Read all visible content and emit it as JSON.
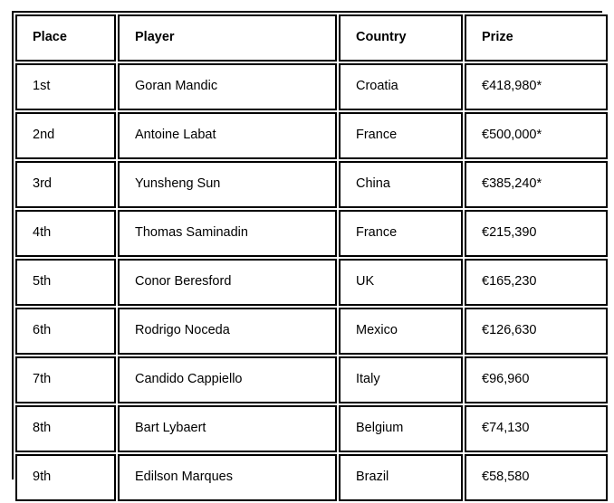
{
  "table": {
    "columns": [
      {
        "key": "place",
        "label": "Place"
      },
      {
        "key": "player",
        "label": "Player"
      },
      {
        "key": "country",
        "label": "Country"
      },
      {
        "key": "prize",
        "label": "Prize"
      }
    ],
    "rows": [
      {
        "place": "1st",
        "player": "Goran Mandic",
        "country": "Croatia",
        "prize": "€418,980*"
      },
      {
        "place": "2nd",
        "player": "Antoine Labat",
        "country": "France",
        "prize": "€500,000*"
      },
      {
        "place": "3rd",
        "player": "Yunsheng Sun",
        "country": "China",
        "prize": "€385,240*"
      },
      {
        "place": "4th",
        "player": "Thomas Saminadin",
        "country": "France",
        "prize": "€215,390"
      },
      {
        "place": "5th",
        "player": "Conor Beresford",
        "country": "UK",
        "prize": "€165,230"
      },
      {
        "place": "6th",
        "player": "Rodrigo Noceda",
        "country": "Mexico",
        "prize": "€126,630"
      },
      {
        "place": "7th",
        "player": "Candido Cappiello",
        "country": "Italy",
        "prize": "€96,960"
      },
      {
        "place": "8th",
        "player": "Bart Lybaert",
        "country": "Belgium",
        "prize": "€74,130"
      },
      {
        "place": "9th",
        "player": "Edilson Marques",
        "country": "Brazil",
        "prize": "€58,580"
      }
    ]
  },
  "colors": {
    "border": "#000000",
    "text": "#000000",
    "background": "#ffffff"
  }
}
